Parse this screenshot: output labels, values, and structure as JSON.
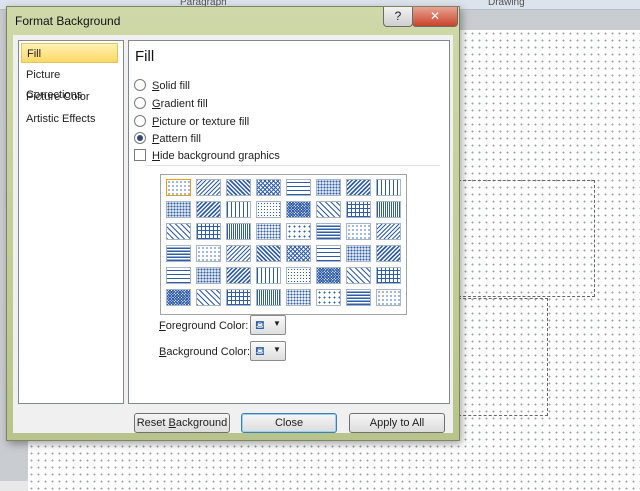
{
  "ribbon": {
    "group1": "Paragraph",
    "group2": "Drawing"
  },
  "dialog": {
    "title": "Format Background",
    "help_label": "?",
    "close_label": "✕",
    "nav": [
      {
        "label": "Fill",
        "active": true
      },
      {
        "label": "Picture Corrections",
        "active": false
      },
      {
        "label": "Picture Color",
        "active": false
      },
      {
        "label": "Artistic Effects",
        "active": false
      }
    ],
    "fill": {
      "heading": "Fill",
      "options": [
        {
          "key": "S",
          "rest": "olid fill",
          "selected": false
        },
        {
          "key": "G",
          "rest": "radient fill",
          "selected": false
        },
        {
          "key": "P",
          "rest": "icture or texture fill",
          "selected": false
        },
        {
          "key": "P",
          "rest": "attern fill",
          "selected": true
        }
      ],
      "hide_bg": {
        "key": "H",
        "rest": "ide background graphics",
        "checked": false
      },
      "pattern_selected_index": 0,
      "foreground": {
        "key": "F",
        "rest": "oreground Color:",
        "icon": "paint-bucket-icon"
      },
      "background": {
        "key": "B",
        "rest": "ackground Color:",
        "icon": "paint-bucket-icon"
      }
    },
    "buttons": {
      "reset_pre": "Reset ",
      "reset_key": "B",
      "reset_post": "ackground",
      "close": "Close",
      "apply_all": "Apply to All"
    },
    "colors": {
      "pattern_fg": "#2f5da8",
      "pattern_bg": "#ffffff",
      "selection": "#e3a21a"
    }
  }
}
